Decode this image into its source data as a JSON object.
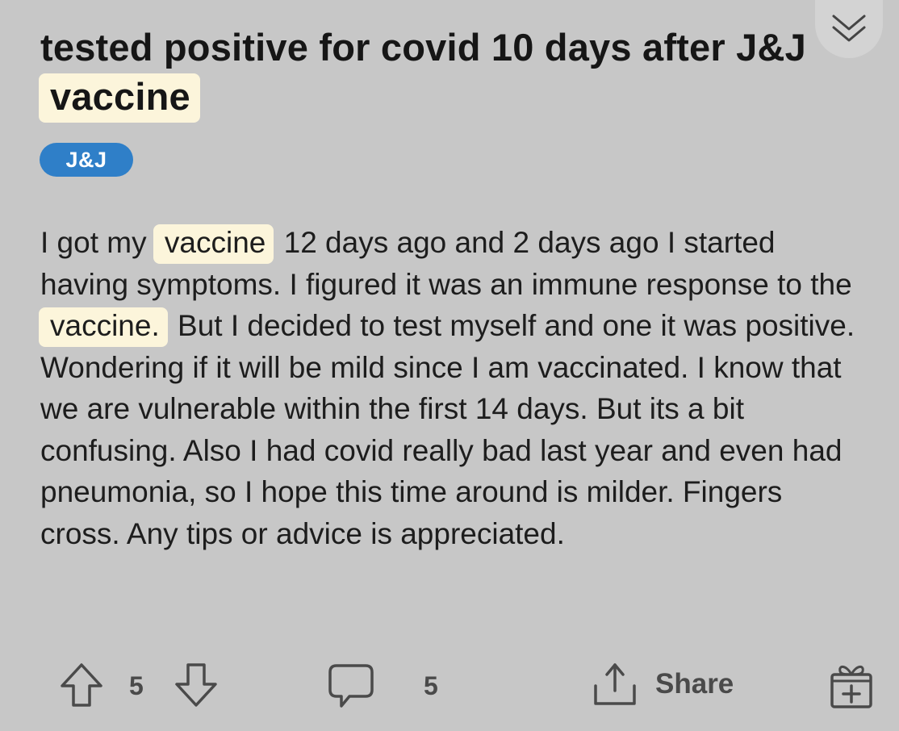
{
  "post": {
    "title_prefix": "tested positive for covid 10 days after J&J ",
    "title_highlight": "vaccine",
    "flair": "J&J",
    "body": {
      "seg1": "I got my ",
      "hl1": "vaccine",
      "seg2": " 12 days ago and 2 days ago I started having symptoms. I figured it was an immune response to the ",
      "hl2": "vaccine.",
      "seg3": " But I decided to test myself and one it was positive. Wondering if it will be mild since I am vaccinated. I know that we are vulnerable within the first 14 days. But its a bit confusing. Also I had covid really bad last year and even had pneumonia, so I hope this time around is milder. Fingers cross. Any tips or advice is appreciated."
    }
  },
  "actions": {
    "vote_count": "5",
    "comment_count": "5",
    "share_label": "Share"
  },
  "icons": {
    "collapse": "double-chevron-down-icon",
    "upvote": "arrow-up-icon",
    "downvote": "arrow-down-icon",
    "comment": "speech-bubble-icon",
    "share": "share-upload-icon",
    "award": "gift-icon"
  },
  "colors": {
    "background": "#c7c7c7",
    "highlight": "#fcf5db",
    "flair": "#2f7fc8",
    "icon": "#4a4a4a"
  }
}
